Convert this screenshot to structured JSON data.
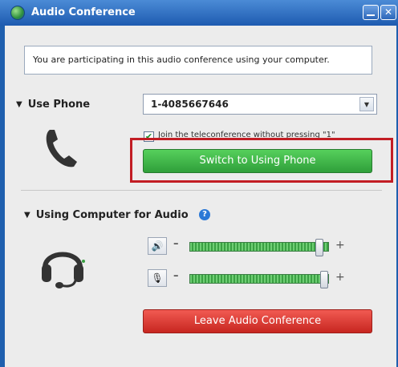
{
  "window": {
    "title": "Audio Conference",
    "close_glyph": "✕"
  },
  "info": {
    "message": "You are participating in this audio conference using your computer."
  },
  "use_phone": {
    "section_label": "Use Phone",
    "toggle_glyph": "▼",
    "phone_number": "1-4085667646",
    "dropdown_glyph": "▼",
    "join_checkbox_checked": true,
    "join_checkbox_glyph": "✔",
    "join_label": "Join the teleconference without pressing \"1\"",
    "switch_button_label": "Switch to Using Phone",
    "icon": "phone-handset-icon"
  },
  "computer_audio": {
    "section_label": "Using Computer for Audio",
    "toggle_glyph": "▼",
    "help_glyph": "?",
    "icon": "headset-icon",
    "speaker": {
      "icon": "speaker-icon",
      "icon_glyph": "🔊",
      "minus": "–",
      "plus": "+",
      "level": 0.96
    },
    "microphone": {
      "icon": "microphone-icon",
      "icon_glyph": "🎙",
      "minus": "–",
      "plus": "+",
      "level": 1.0
    },
    "leave_button_label": "Leave Audio Conference"
  },
  "colors": {
    "titlebar": "#1e5bb0",
    "switch_button": "#3db046",
    "leave_button": "#d9332c",
    "highlight": "#c21d24"
  }
}
